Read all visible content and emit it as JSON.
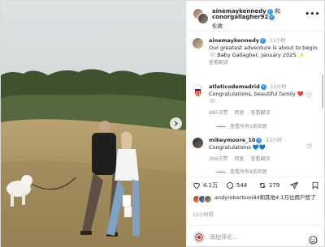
{
  "post": {
    "header": {
      "user1": "ainemaykennedy",
      "and_word": "和",
      "user2": "conorgallagher92",
      "location": "伦敦",
      "more_label": "•••"
    },
    "caption": {
      "user": "ainemaykennedy",
      "time": "11小时",
      "text": "Our greatest adventure is about to begin 🤍 Baby Gallagher, January 2025 ✨",
      "translate": "查看翻译"
    },
    "comments": [
      {
        "user": "atleticodemadrid",
        "text": "Congratulations, beautiful family ❤️🤍",
        "time": "11小时",
        "likes": "485次赞",
        "reply": "回复",
        "translate": "查看翻译",
        "view_replies": "查看所有2条回复"
      },
      {
        "user": "mikeymoore_10",
        "text": "Congratulations 💙💙",
        "time": "11小时",
        "likes": "396次赞",
        "reply": "回复",
        "translate": "查看翻译",
        "view_replies": "查看所有8条回复"
      }
    ],
    "actions": {
      "likes": "4.1万",
      "comments": "544",
      "reposts": "179"
    },
    "liked_by": "andyrobertson94和其他4.1万位用户赞了",
    "timestamp": "11小时前",
    "composer": {
      "placeholder": "添加评论..."
    }
  },
  "colors": {
    "verified": "#3897f0",
    "meta": "#8e8e8e",
    "text": "#262626"
  }
}
